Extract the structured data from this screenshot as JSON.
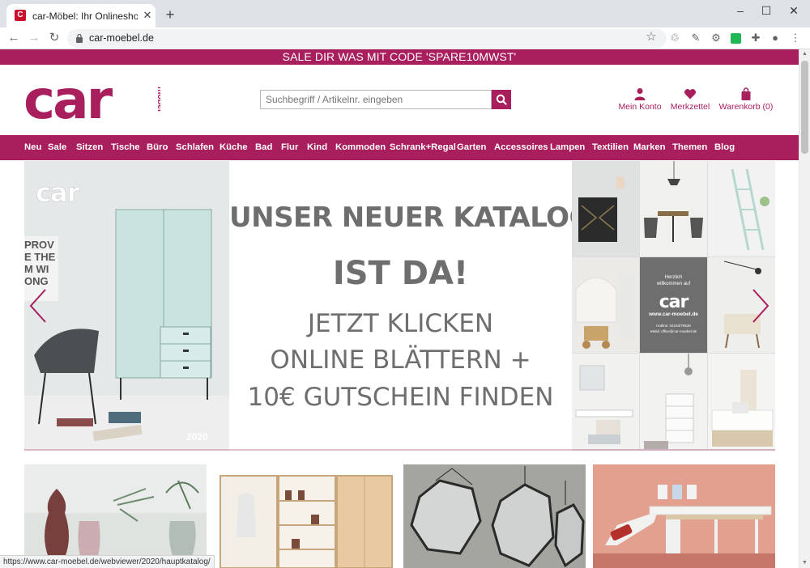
{
  "browser": {
    "tab_title": "car-Möbel: Ihr Onlineshop für M",
    "tab_favicon_letter": "C",
    "url": "car-moebel.de",
    "status_url": "https://www.car-moebel.de/webviewer/2020/hauptkatalog/"
  },
  "promo": {
    "text": "SALE DIR WAS MIT CODE 'SPARE10MWST'"
  },
  "logo": {
    "word": "car",
    "sub": "möbel",
    "color": "#a91e5d"
  },
  "search": {
    "placeholder": "Suchbegriff / Artikelnr. eingeben"
  },
  "header_actions": {
    "account": "Mein Konto",
    "wishlist": "Merkzettel",
    "cart": "Warenkorb (0)"
  },
  "nav": {
    "items": [
      "Neu",
      "Sale",
      "Sitzen",
      "Tische",
      "Büro",
      "Schlafen",
      "Küche",
      "Bad",
      "Flur",
      "Kind",
      "Kommoden",
      "Schrank+Regal",
      "Garten",
      "Accessoires",
      "Lampen",
      "Textilien",
      "Marken",
      "Themen",
      "Blog"
    ]
  },
  "hero": {
    "headline_1": "UNSER NEUER KATALOG",
    "headline_2": "IST DA!",
    "line_1": "JETZT KLICKEN",
    "line_2": "ONLINE BLÄTTERN +",
    "line_3": "10€ GUTSCHEIN FINDEN",
    "catalog_logo": "car",
    "catalog_year": "2020",
    "poster_text": "PROV\nE THE\nM WI\nONG",
    "catalog_card_greeting": "Herzlich willkommen auf",
    "catalog_card_logo": "car",
    "catalog_card_url": "www.car-moebel.de",
    "catalog_card_contact": "Hotline: 04193/75530\neMail: office@car-moebel.de"
  },
  "colors": {
    "brand": "#a91e5d",
    "hero_text": "#6e6e6e"
  }
}
